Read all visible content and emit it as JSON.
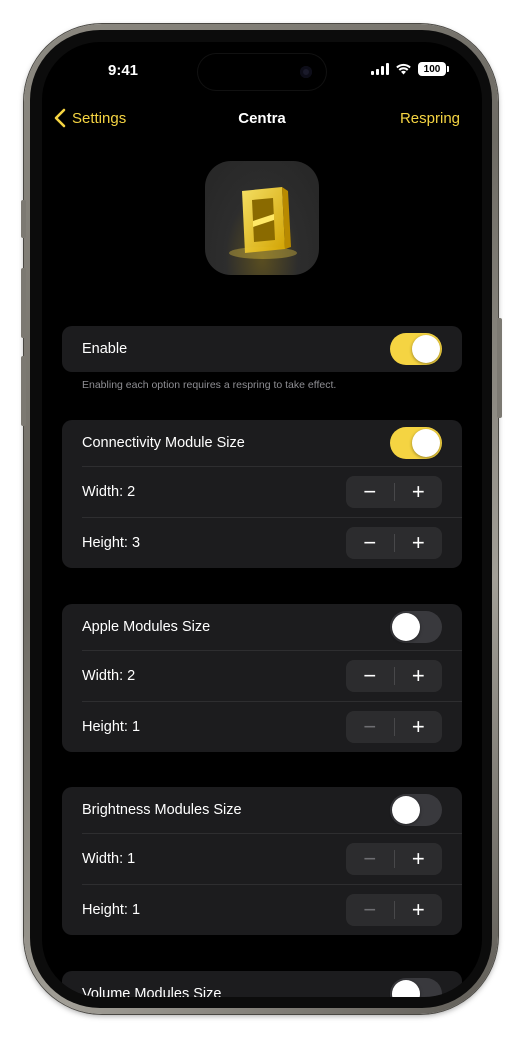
{
  "status_bar": {
    "time": "9:41",
    "battery": "100"
  },
  "nav": {
    "back_label": "Settings",
    "title": "Centra",
    "action_label": "Respring"
  },
  "enable_section": {
    "label": "Enable",
    "on": true,
    "footnote": "Enabling each option requires a respring to take effect."
  },
  "sections": [
    {
      "label": "Connectivity Module Size",
      "on": true,
      "width_label": "Width: 2",
      "height_label": "Height: 3"
    },
    {
      "label": "Apple Modules Size",
      "on": false,
      "width_label": "Width: 2",
      "height_label": "Height: 1"
    },
    {
      "label": "Brightness Modules Size",
      "on": false,
      "width_label": "Width: 1",
      "height_label": "Height: 1"
    },
    {
      "label": "Volume Modules Size",
      "on": false
    }
  ],
  "colors": {
    "accent": "#f5d442",
    "background": "#000000",
    "card": "#1c1c1e"
  },
  "icons": {
    "minus": "−",
    "plus": "+"
  }
}
